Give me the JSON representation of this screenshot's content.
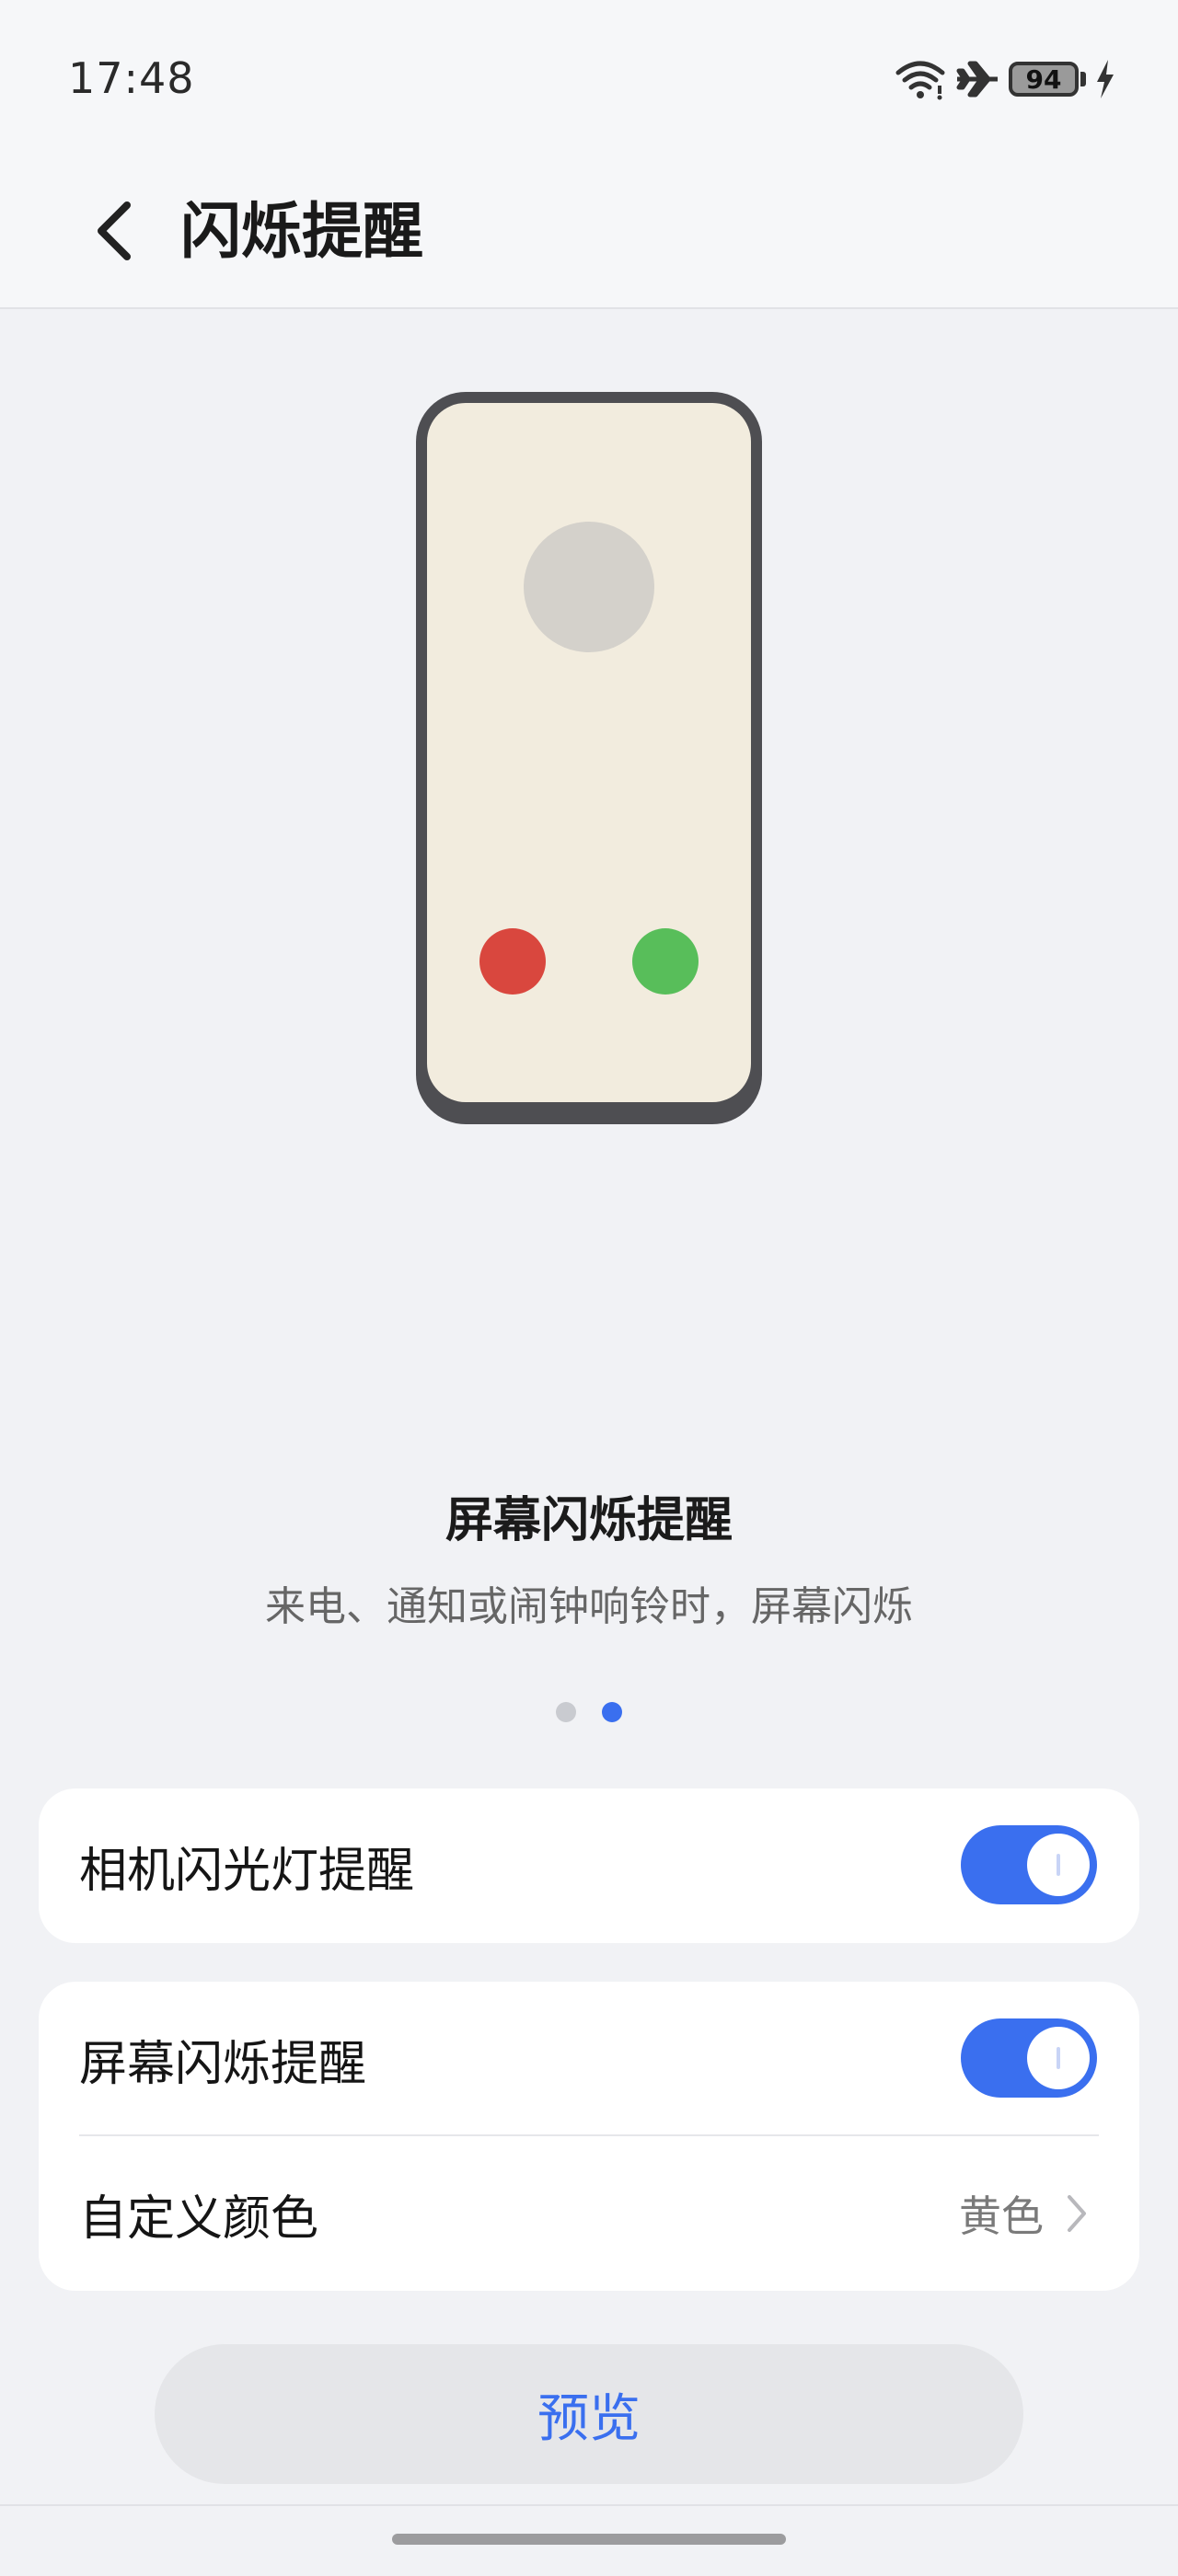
{
  "status_bar": {
    "time": "17:48",
    "battery_level": "94",
    "icons": [
      "wifi-icon",
      "airplane-mode-icon",
      "battery-icon",
      "charging-icon"
    ]
  },
  "header": {
    "title": "闪烁提醒",
    "back_icon": "back-arrow-icon"
  },
  "illustration": {
    "colors": {
      "frame": "#4E4E52",
      "screen": "#F2ECDE",
      "avatar": "#D4D1CB",
      "decline": "#D9473E",
      "accept": "#58BE5A"
    }
  },
  "caption": {
    "title": "屏幕闪烁提醒",
    "subtitle": "来电、通知或闹钟响铃时，屏幕闪烁"
  },
  "pager": {
    "count": 2,
    "active_index": 1
  },
  "settings": {
    "camera_flash": {
      "label": "相机闪光灯提醒",
      "enabled": true
    },
    "screen_flash": {
      "label": "屏幕闪烁提醒",
      "enabled": true
    },
    "custom_color": {
      "label": "自定义颜色",
      "value": "黄色"
    }
  },
  "preview_button": {
    "label": "预览"
  },
  "colors": {
    "accent": "#3A6FEF",
    "background": "#F1F2F5"
  }
}
